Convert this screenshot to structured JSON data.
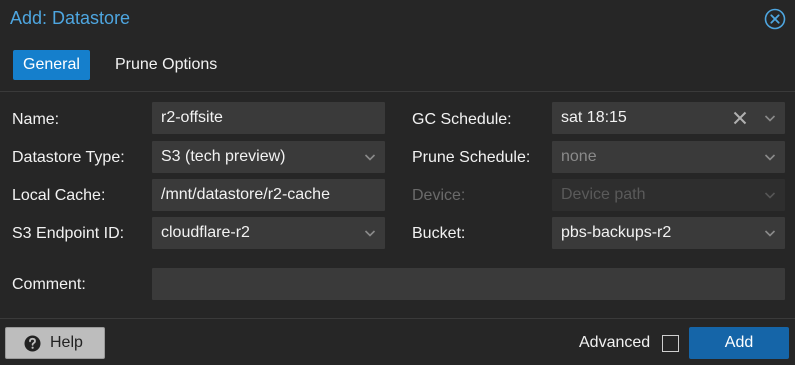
{
  "dialog": {
    "title": "Add: Datastore"
  },
  "tabs": [
    {
      "label": "General",
      "active": true
    },
    {
      "label": "Prune Options",
      "active": false
    }
  ],
  "form": {
    "left": [
      {
        "label": "Name:",
        "value": "r2-offsite",
        "type": "text"
      },
      {
        "label": "Datastore Type:",
        "value": "S3 (tech preview)",
        "type": "select"
      },
      {
        "label": "Local Cache:",
        "value": "/mnt/datastore/r2-cache",
        "type": "text"
      },
      {
        "label": "S3 Endpoint ID:",
        "value": "cloudflare-r2",
        "type": "select"
      }
    ],
    "right": [
      {
        "label": "GC Schedule:",
        "value": "sat 18:15",
        "type": "combo-clearable"
      },
      {
        "label": "Prune Schedule:",
        "placeholder": "none",
        "type": "select"
      },
      {
        "label": "Device:",
        "placeholder": "Device path",
        "type": "select",
        "disabled": true
      },
      {
        "label": "Bucket:",
        "value": "pbs-backups-r2",
        "type": "select"
      }
    ],
    "comment": {
      "label": "Comment:",
      "value": ""
    }
  },
  "footer": {
    "help_label": "Help",
    "advanced_label": "Advanced",
    "advanced_checked": false,
    "add_label": "Add"
  },
  "icons": {
    "close": "close-circle-icon",
    "help": "question-circle-icon",
    "chevron": "chevron-down-icon",
    "clear": "clear-x-icon"
  },
  "colors": {
    "accent": "#157fcc",
    "title": "#4ea6e0",
    "primary_button": "#1565a8",
    "background": "#262626",
    "field": "#3a3a3a"
  }
}
